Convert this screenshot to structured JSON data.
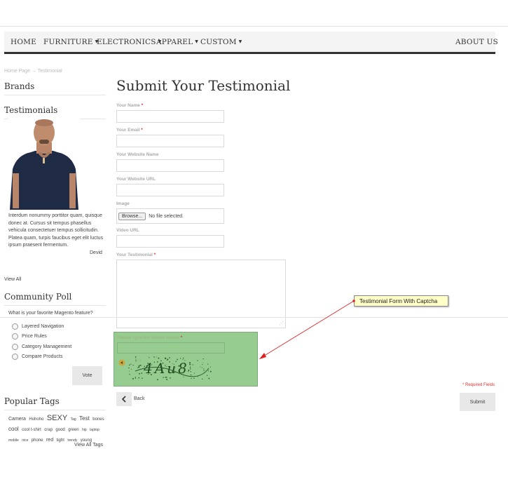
{
  "nav": {
    "items": [
      {
        "label": "HOME",
        "caret": false
      },
      {
        "label": "FURNITURE",
        "caret": true
      },
      {
        "label": "ELECTRONICS",
        "caret": true
      },
      {
        "label": "APPAREL",
        "caret": true
      },
      {
        "label": "CUSTOM",
        "caret": true
      }
    ],
    "right": "ABOUT US",
    "caret_glyph": "▼"
  },
  "breadcrumb": "Home Page → Testimonial",
  "sidebar": {
    "brands_title": "Brands",
    "testimonials_title": "Testimonials",
    "quote": "Interdum nonummy porttitor quam, quisque donec at. Cursus sit tempus phasellus vehicula consectetuer tempus sollicitudin. Platea quam, turpis faucibus eget elit luctus ipsum praesent fermentum.",
    "author": "Devid",
    "view_all": "View All",
    "poll_title": "Community Poll",
    "poll_question": "What is your favorite Magento feature?",
    "poll_options": [
      "Layered Navigation",
      "Price Rules",
      "Category Management",
      "Compare Products"
    ],
    "vote_label": "Vote",
    "tags_title": "Popular Tags",
    "tags": [
      {
        "text": "Camera",
        "size": 7
      },
      {
        "text": "Hohoho",
        "size": 6
      },
      {
        "text": "SEXY",
        "size": 11
      },
      {
        "text": "Tag",
        "size": 5
      },
      {
        "text": "Test",
        "size": 8
      },
      {
        "text": "bones",
        "size": 6
      },
      {
        "text": "cool",
        "size": 8
      },
      {
        "text": "cool t-shirt",
        "size": 6
      },
      {
        "text": "crap",
        "size": 6
      },
      {
        "text": "good",
        "size": 6
      },
      {
        "text": "green",
        "size": 6
      },
      {
        "text": "hip",
        "size": 5
      },
      {
        "text": "laptop",
        "size": 5
      },
      {
        "text": "mobile",
        "size": 5
      },
      {
        "text": "nice",
        "size": 5
      },
      {
        "text": "phone",
        "size": 6
      },
      {
        "text": "red",
        "size": 7
      },
      {
        "text": "tight",
        "size": 6
      },
      {
        "text": "trendy",
        "size": 5
      },
      {
        "text": "young",
        "size": 6
      }
    ],
    "view_all_tags": "View All Tags"
  },
  "main": {
    "title": "Submit Your Testimonial",
    "fields": {
      "name": {
        "label": "Your Name",
        "required": "*"
      },
      "email": {
        "label": "Your Email",
        "required": "*"
      },
      "website_name": {
        "label": "Your Website Name"
      },
      "website_url": {
        "label": "Your Website URL"
      },
      "image": {
        "label": "Image",
        "browse": "Browse...",
        "no_file": "No file selected."
      },
      "video": {
        "label": "Video URL"
      },
      "testimonial": {
        "label": "Your Testimonial",
        "required": "*"
      }
    },
    "captcha": {
      "label": "Please type the letters below",
      "required": "*",
      "code": "4Au8"
    },
    "back_label": "Back",
    "required_note": "* Required Fields",
    "submit_label": "Submit"
  },
  "annotation": {
    "text": "Testimonial Form With Captcha"
  },
  "colors": {
    "captcha_bg": "#97cc91",
    "annotation_bg": "#ffffc8",
    "arrow": "#e02020",
    "required": "#e03030",
    "nav_border": "#333333"
  }
}
